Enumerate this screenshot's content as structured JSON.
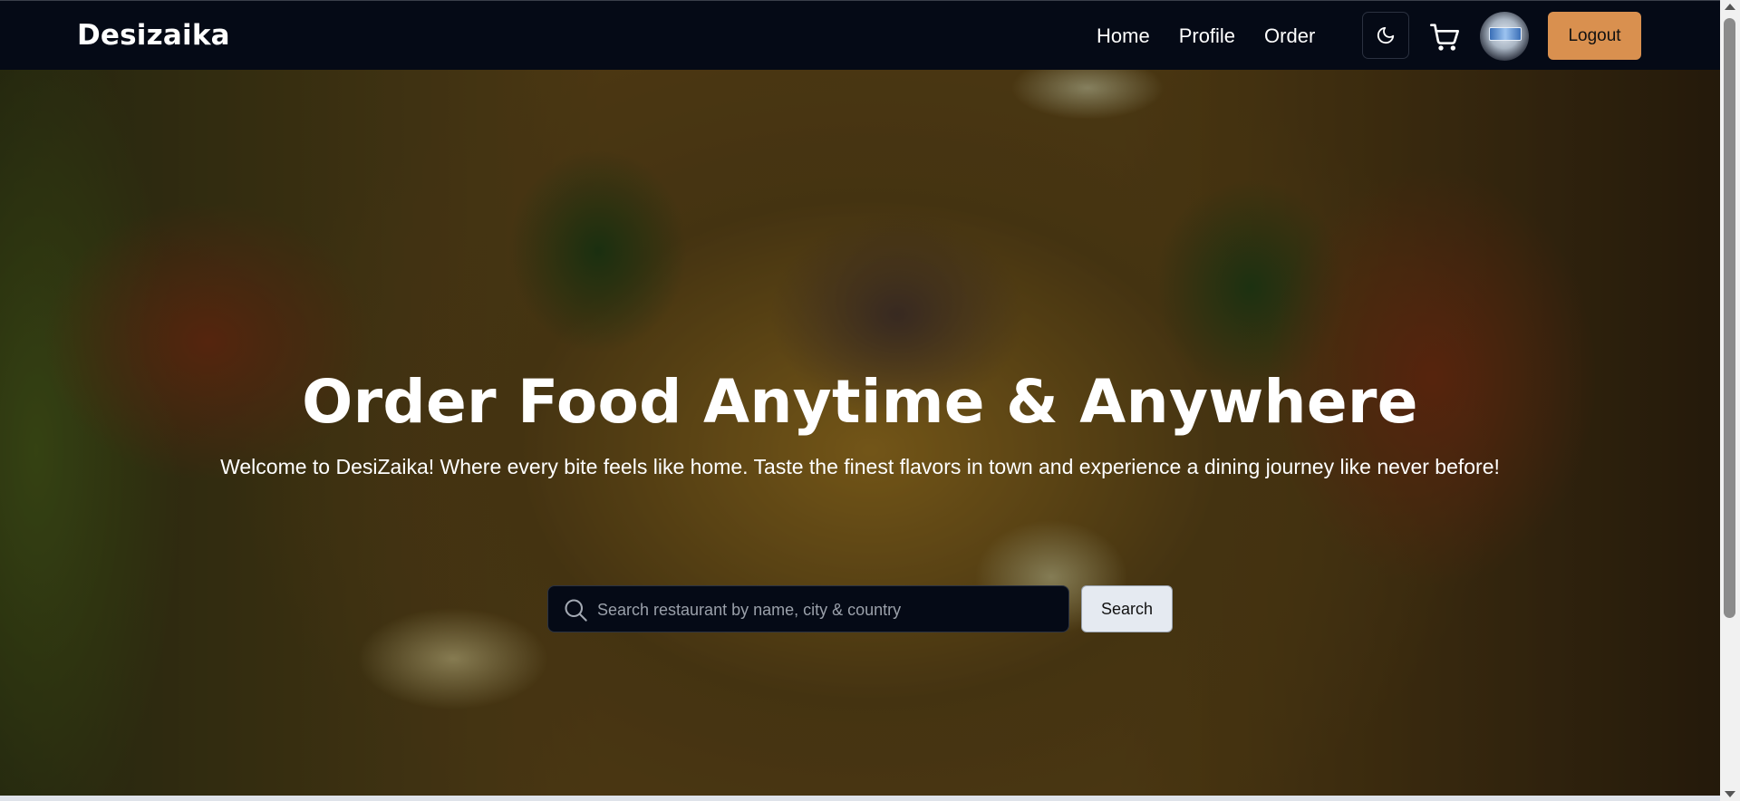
{
  "navbar": {
    "brand": "Desizaika",
    "links": [
      "Home",
      "Profile",
      "Order"
    ],
    "theme_toggle_icon": "moon-icon",
    "cart_icon": "cart-icon",
    "logout_label": "Logout"
  },
  "hero": {
    "title": "Order Food Anytime & Anywhere",
    "subtitle": "Welcome to DesiZaika! Where every bite feels like home. Taste the finest flavors in town and experience a dining journey like never before!",
    "search": {
      "placeholder": "Search restaurant by name, city & country",
      "value": "",
      "button_label": "Search"
    }
  },
  "colors": {
    "navbar_bg": "#050a16",
    "logout_bg": "#d9904f",
    "search_bg": "#050a16",
    "search_button_bg": "#e5eaf1"
  }
}
